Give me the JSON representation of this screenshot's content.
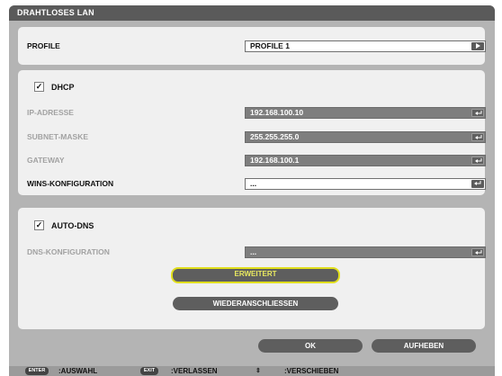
{
  "window": {
    "title": "DRAHTLOSES LAN"
  },
  "profile": {
    "label": "PROFILE",
    "value": "PROFILE 1"
  },
  "dhcp": {
    "checkbox_label": "DHCP",
    "checked": true,
    "rows": [
      {
        "label": "IP-ADRESSE",
        "value": "192.168.100.10"
      },
      {
        "label": "SUBNET-MASKE",
        "value": "255.255.255.0"
      },
      {
        "label": "GATEWAY",
        "value": "192.168.100.1"
      }
    ],
    "wins": {
      "label": "WINS-KONFIGURATION",
      "value": "..."
    }
  },
  "dns": {
    "checkbox_label": "AUTO-DNS",
    "checked": true,
    "config": {
      "label": "DNS-KONFIGURATION",
      "value": "..."
    }
  },
  "buttons": {
    "advanced": "ERWEITERT",
    "reconnect": "WIEDERANSCHLIESSEN",
    "ok": "OK",
    "cancel": "AUFHEBEN"
  },
  "footer": {
    "enter_key": "ENTER",
    "enter_text": ":AUSWAHL",
    "exit_key": "EXIT",
    "exit_text": ":VERLASSEN",
    "move_text": ":VERSCHIEBEN"
  },
  "colors": {
    "window_bg": "#b4b4b4",
    "titlebar": "#5a5a5a",
    "panel": "#f0f0f0",
    "focus_outline": "#e0de1c",
    "disabled_field": "#7e7e7e"
  }
}
